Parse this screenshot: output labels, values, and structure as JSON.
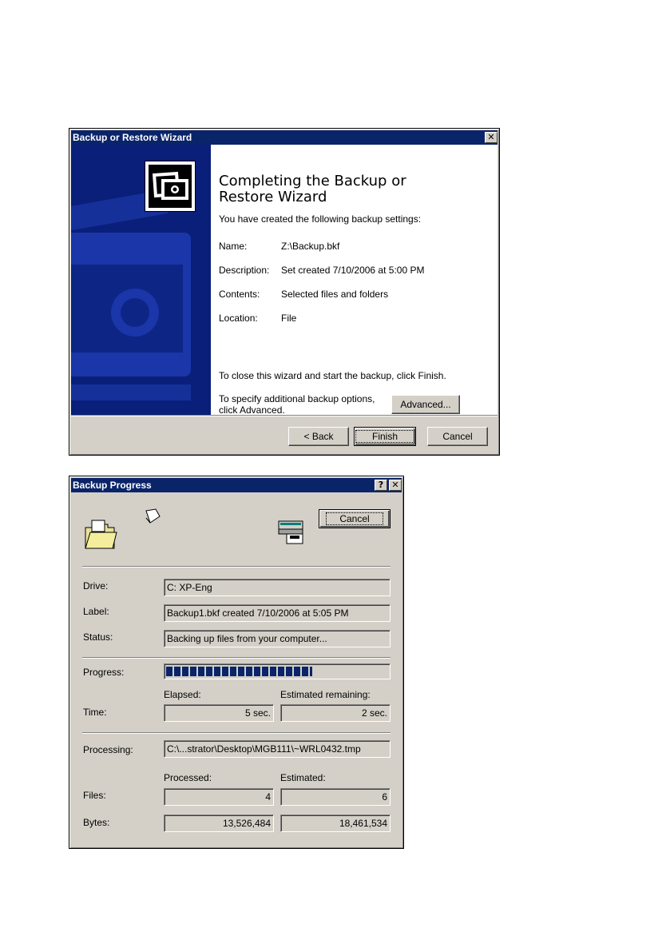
{
  "wizard": {
    "title": "Backup or Restore Wizard",
    "heading_line1": "Completing the Backup or",
    "heading_line2": "Restore Wizard",
    "subtitle": "You have created the following backup settings:",
    "settings": [
      {
        "label": "Name:",
        "value": "Z:\\Backup.bkf"
      },
      {
        "label": "Description:",
        "value": "Set created 7/10/2006 at 5:00 PM"
      },
      {
        "label": "Contents:",
        "value": "Selected files and folders"
      },
      {
        "label": "Location:",
        "value": "File"
      }
    ],
    "close_note": "To close this wizard and start the backup, click Finish.",
    "advanced_note_line1": "To specify additional backup options,",
    "advanced_note_line2": "click Advanced.",
    "advanced_button": "Advanced...",
    "back_button": "< Back",
    "finish_button": "Finish",
    "cancel_button": "Cancel"
  },
  "progress": {
    "title": "Backup Progress",
    "help_glyph": "?",
    "close_glyph": "✕",
    "cancel_button": "Cancel",
    "drive_label": "Drive:",
    "drive_value": "C: XP-Eng",
    "label_label": "Label:",
    "label_value": "Backup1.bkf created 7/10/2006 at 5:05 PM",
    "status_label": "Status:",
    "status_value": "Backing up files from your computer...",
    "progress_label": "Progress:",
    "progress_fraction": 0.66,
    "elapsed_header": "Elapsed:",
    "remaining_header": "Estimated remaining:",
    "time_label": "Time:",
    "elapsed_value": "5 sec.",
    "remaining_value": "2 sec.",
    "processing_label": "Processing:",
    "processing_value": "C:\\...strator\\Desktop\\MGB111\\~WRL0432.tmp",
    "processed_header": "Processed:",
    "estimated_header": "Estimated:",
    "files_label": "Files:",
    "files_processed": "4",
    "files_estimated": "6",
    "bytes_label": "Bytes:",
    "bytes_processed": "13,526,484",
    "bytes_estimated": "18,461,534"
  },
  "icons": [
    "folder-icon",
    "flying-paper-icon",
    "backup-device-icon",
    "backup-wizard-icon"
  ]
}
